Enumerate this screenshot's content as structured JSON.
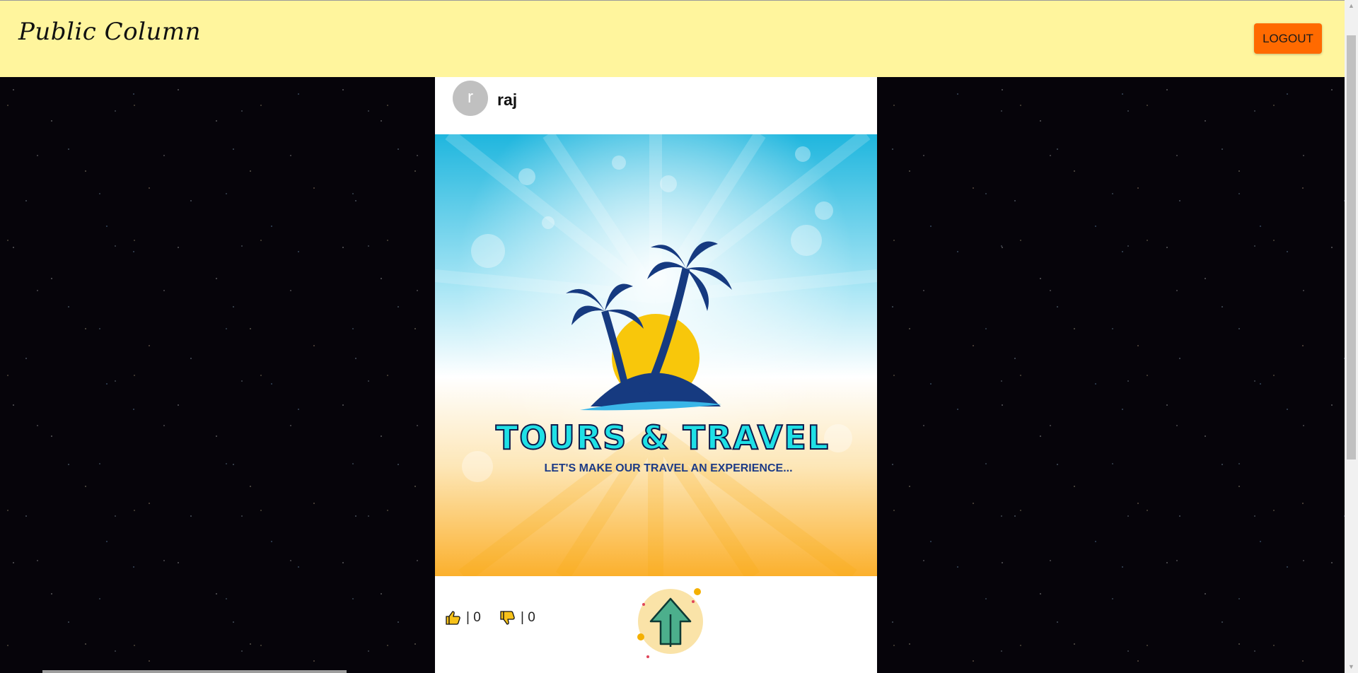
{
  "header": {
    "brand": "Public Column",
    "logout_label": "LOGOUT"
  },
  "post": {
    "avatar_initial": "r",
    "username": "raj",
    "image": {
      "headline": "TOURS & TRAVEL",
      "tagline": "LET'S MAKE OUR TRAVEL AN EXPERIENCE..."
    },
    "likes": {
      "icon": "thumbs-up-icon",
      "text": "| 0",
      "count": 0
    },
    "dislikes": {
      "icon": "thumbs-down-icon",
      "text": "| 0",
      "count": 0
    }
  },
  "scroll_top": {
    "icon": "arrow-up-icon"
  },
  "colors": {
    "header_bg": "#fff59d",
    "logout_bg": "#ff6a00",
    "page_bg": "#07050a",
    "card_bg": "#ffffff",
    "avatar_bg": "#c0c0c0"
  }
}
